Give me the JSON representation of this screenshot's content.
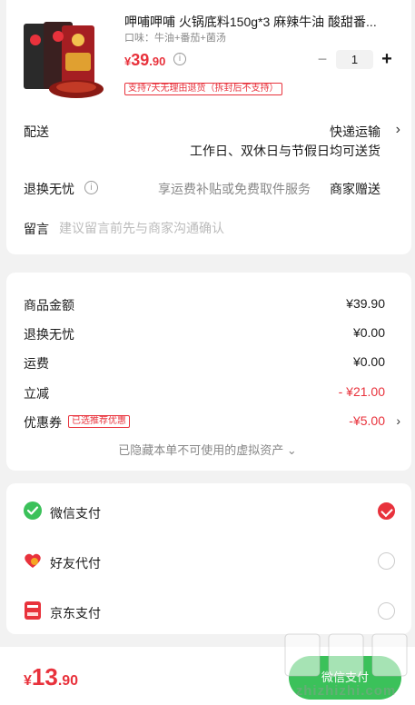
{
  "product": {
    "title": "呷哺呷哺 火锅底料150g*3 麻辣牛油 酸甜番...",
    "spec": "口味：牛油+番茄+菌汤",
    "price_currency": "¥",
    "price_int": "39",
    "price_dec": ".90",
    "info_glyph": "i",
    "quantity": "1",
    "minus": "−",
    "plus": "+",
    "return_tag": "支持7天无理由退货（拆封后不支持）"
  },
  "shipping": {
    "label": "配送",
    "value": "快递运输",
    "note": "工作日、双休日与节假日均可送货",
    "chevron": "›"
  },
  "exchange": {
    "label": "退换无忧",
    "info_glyph": "i",
    "desc": "享运费补贴或免费取件服务",
    "value": "商家赠送"
  },
  "message": {
    "label": "留言",
    "placeholder": "建议留言前先与商家沟通确认"
  },
  "breakdown": {
    "items": [
      {
        "label": "商品金额",
        "value": "¥39.90"
      },
      {
        "label": "退换无忧",
        "value": "¥0.00"
      },
      {
        "label": "运费",
        "value": "¥0.00"
      },
      {
        "label": "立减",
        "value": "- ¥21.00"
      },
      {
        "label": "优惠券",
        "value": "-¥5.00"
      }
    ],
    "coupon_tag": "已选推荐优惠",
    "chevron": "›",
    "hidden_note": "已隐藏本单不可使用的虚拟资产 ⌄"
  },
  "payment": {
    "methods": [
      {
        "label": "微信支付",
        "selected": true
      },
      {
        "label": "好友代付",
        "selected": false
      },
      {
        "label": "京东支付",
        "selected": false
      }
    ]
  },
  "footer": {
    "total_currency": "¥",
    "total_int": "13",
    "total_dec": ".90",
    "pay_button": "微信支付",
    "watermark": "zhizhizhi.com"
  },
  "colors": {
    "accent_red": "#e8323c",
    "wechat_green": "#3bc15a"
  }
}
